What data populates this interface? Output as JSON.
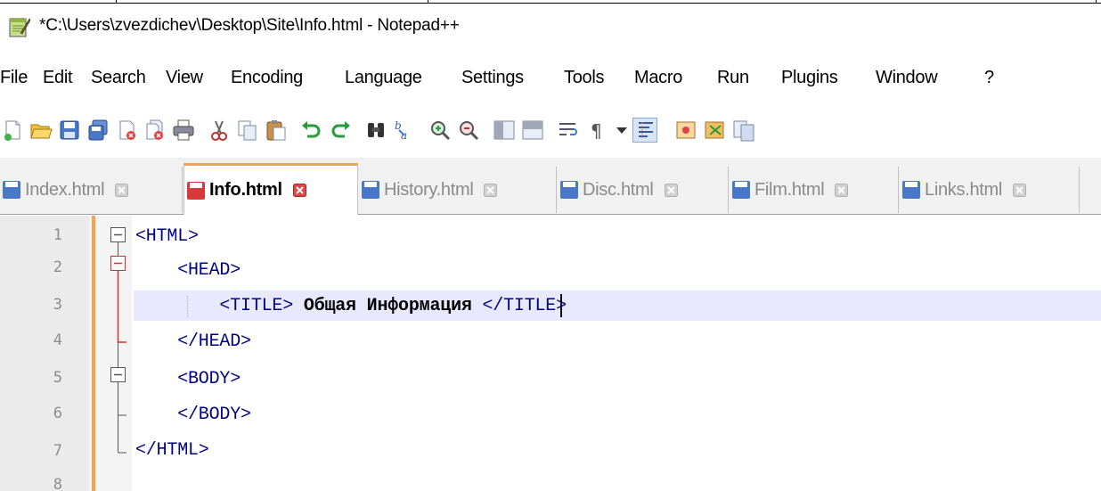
{
  "window": {
    "title": "*C:\\Users\\zvezdichev\\Desktop\\Site\\Info.html - Notepad++"
  },
  "menu": [
    "File",
    "Edit",
    "Search",
    "View",
    "Encoding",
    "Language",
    "Settings",
    "Tools",
    "Macro",
    "Run",
    "Plugins",
    "Window",
    "?"
  ],
  "toolbar": {
    "icons": [
      "new-file-icon",
      "open-file-icon",
      "save-icon",
      "save-all-icon",
      "close-icon",
      "close-all-icon",
      "print-icon",
      "cut-icon",
      "copy-icon",
      "paste-icon",
      "undo-icon",
      "redo-icon",
      "find-icon",
      "replace-icon",
      "zoom-in-icon",
      "zoom-out-icon",
      "sync-vertical-icon",
      "sync-horizontal-icon",
      "word-wrap-icon",
      "show-all-chars-icon",
      "dropdown-icon",
      "indent-guide-icon",
      "macro-record-icon",
      "macro-play-icon",
      "doc-map-icon"
    ]
  },
  "tabs": [
    {
      "label": "Index.html",
      "active": false
    },
    {
      "label": "Info.html",
      "active": true
    },
    {
      "label": "History.html",
      "active": false
    },
    {
      "label": "Disc.html",
      "active": false
    },
    {
      "label": "Film.html",
      "active": false
    },
    {
      "label": "Links.html",
      "active": false
    }
  ],
  "editor": {
    "line_numbers": [
      "1",
      "2",
      "3",
      "4",
      "5",
      "6",
      "7",
      "8"
    ],
    "lines": [
      {
        "tag1": "<HTML>"
      },
      {
        "tag1": "    <HEAD>"
      },
      {
        "tag1": "        <TITLE> ",
        "text": "Общая Информация",
        "tag2": " </TITLE>"
      },
      {
        "tag1": "    </HEAD>"
      },
      {
        "tag1": "    <BODY>"
      },
      {
        "tag1": "    </BODY>"
      },
      {
        "tag1": "</HTML>"
      },
      {
        "tag1": ""
      }
    ],
    "current_line": 3
  },
  "colors": {
    "accent": "#f6a14b",
    "tag": "#000080",
    "current_line_bg": "#e8e8ff",
    "fold_red": "#d03030"
  }
}
